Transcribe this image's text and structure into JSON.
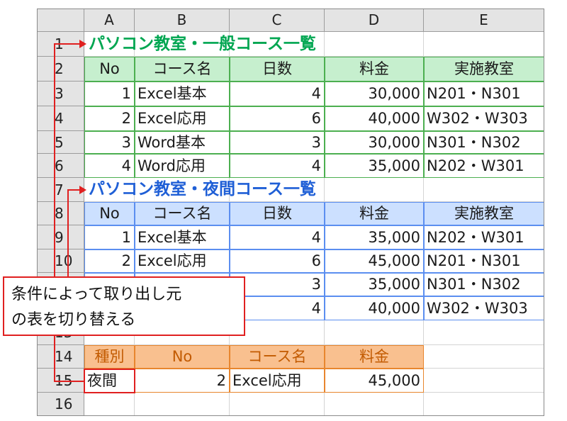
{
  "columns": [
    "A",
    "B",
    "C",
    "D",
    "E"
  ],
  "rows": [
    "1",
    "2",
    "3",
    "4",
    "5",
    "6",
    "7",
    "8",
    "9",
    "10",
    "13",
    "14",
    "15",
    "16"
  ],
  "table_general": {
    "title": "パソコン教室・一般コース一覧",
    "headers": [
      "No",
      "コース名",
      "日数",
      "料金",
      "実施教室"
    ],
    "records": [
      [
        "1",
        "Excel基本",
        "4",
        "30,000",
        "N201・N301"
      ],
      [
        "2",
        "Excel応用",
        "6",
        "40,000",
        "W302・W303"
      ],
      [
        "3",
        "Word基本",
        "3",
        "30,000",
        "N301・N302"
      ],
      [
        "4",
        "Word応用",
        "4",
        "35,000",
        "N202・W301"
      ]
    ]
  },
  "table_night": {
    "title": "パソコン教室・夜間コース一覧",
    "headers": [
      "No",
      "コース名",
      "日数",
      "料金",
      "実施教室"
    ],
    "records": [
      [
        "1",
        "Excel基本",
        "4",
        "35,000",
        "N202・W301"
      ],
      [
        "2",
        "Excel応用",
        "6",
        "45,000",
        "N201・N301"
      ],
      [
        "",
        "",
        "3",
        "35,000",
        "N301・N302"
      ],
      [
        "",
        "",
        "4",
        "40,000",
        "W302・W303"
      ]
    ]
  },
  "lookup": {
    "headers": [
      "種別",
      "No",
      "コース名",
      "料金"
    ],
    "values": [
      "夜間",
      "2",
      "Excel応用",
      "45,000"
    ]
  },
  "callout": {
    "line1": "条件によって取り出し元",
    "line2": "の表を切り替える"
  },
  "colors": {
    "green_fill": "#c6efce",
    "green_title": "#00a651",
    "green_border": "#4caf50",
    "blue_fill": "#cce0ff",
    "blue_title": "#1f5fd6",
    "blue_border": "#5b8ef0",
    "orange_fill": "#f9c08f",
    "orange_text": "#c25a00",
    "orange_border": "#e8862e",
    "red": "#e02020"
  }
}
